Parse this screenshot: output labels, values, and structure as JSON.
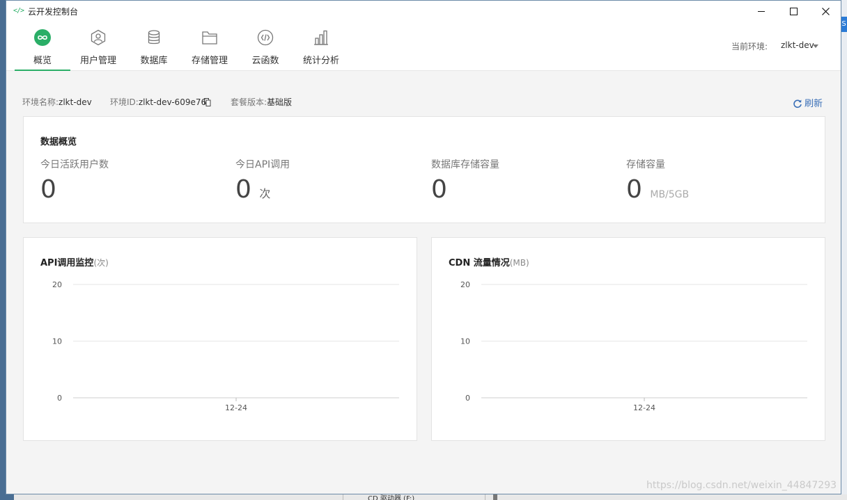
{
  "window": {
    "title": "云开发控制台",
    "app_icon": "</>",
    "controls": [
      "minimize",
      "maximize",
      "close"
    ]
  },
  "nav": {
    "items": [
      {
        "label": "概览",
        "icon": "overview-icon",
        "active": true
      },
      {
        "label": "用户管理",
        "icon": "user-icon",
        "active": false
      },
      {
        "label": "数据库",
        "icon": "database-icon",
        "active": false
      },
      {
        "label": "存储管理",
        "icon": "folder-icon",
        "active": false
      },
      {
        "label": "云函数",
        "icon": "cloud-function-icon",
        "active": false
      },
      {
        "label": "统计分析",
        "icon": "chart-icon",
        "active": false
      }
    ],
    "env_label": "当前环境:",
    "env_value": "zlkt-dev"
  },
  "info": {
    "env_name_label": "环境名称:",
    "env_name": "zlkt-dev",
    "env_id_label": "环境ID:",
    "env_id": "zlkt-dev-609e76",
    "plan_label": "套餐版本:",
    "plan": "基础版",
    "refresh_label": "刷新"
  },
  "overview": {
    "title": "数据概览",
    "metrics": [
      {
        "label": "今日活跃用户数",
        "value": "0",
        "unit": ""
      },
      {
        "label": "今日API调用",
        "value": "0",
        "unit": "次"
      },
      {
        "label": "数据库存储容量",
        "value": "0",
        "unit": ""
      },
      {
        "label": "存储容量",
        "value": "0",
        "unit": "MB/5GB"
      }
    ]
  },
  "chart_data": [
    {
      "type": "line",
      "title": "API调用监控",
      "title_unit": "(次)",
      "categories": [
        "12-24"
      ],
      "series": [
        {
          "values": [
            0
          ]
        }
      ],
      "ylim": [
        0,
        20
      ],
      "yticks": [
        "20",
        "10",
        "0"
      ],
      "grid": true
    },
    {
      "type": "line",
      "title": "CDN 流量情况",
      "title_unit": "(MB)",
      "categories": [
        "12-24"
      ],
      "series": [
        {
          "values": [
            0
          ]
        }
      ],
      "ylim": [
        0,
        20
      ],
      "yticks": [
        "20",
        "10",
        "0"
      ],
      "grid": true
    }
  ],
  "background": {
    "taskbar_fragment": "CD 驱动器 (F:)",
    "right_tab": "S",
    "watermark": "https://blog.csdn.net/weixin_44847293"
  },
  "colors": {
    "accent": "#2aae67",
    "link": "#3a6fb7"
  }
}
